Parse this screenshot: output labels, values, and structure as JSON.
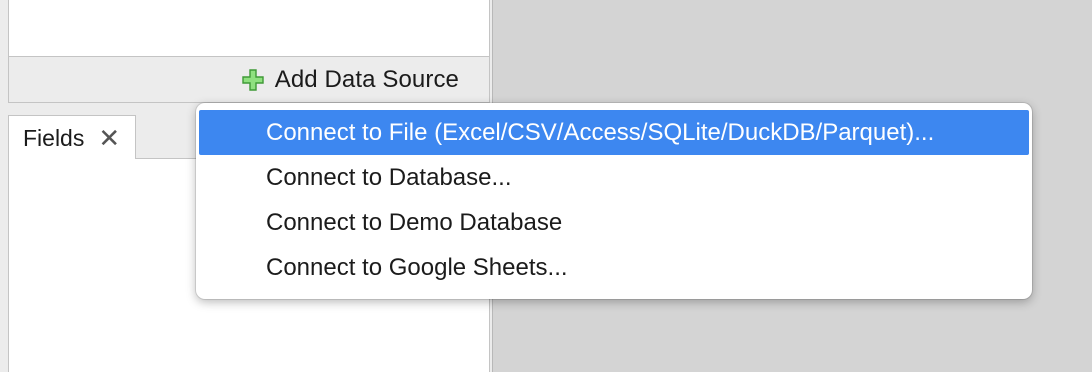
{
  "add_source": {
    "label": "Add Data Source",
    "icon": "plus-icon",
    "icon_color": "#5cc44e"
  },
  "fields_panel": {
    "tab_label": "Fields",
    "close_glyph": "✕"
  },
  "menu": {
    "highlight_color": "#3d87f0",
    "items": [
      {
        "label": "Connect to File (Excel/CSV/Access/SQLite/DuckDB/Parquet)...",
        "highlighted": true
      },
      {
        "label": "Connect to Database...",
        "highlighted": false
      },
      {
        "label": "Connect to Demo Database",
        "highlighted": false
      },
      {
        "label": "Connect to Google Sheets...",
        "highlighted": false
      }
    ]
  }
}
